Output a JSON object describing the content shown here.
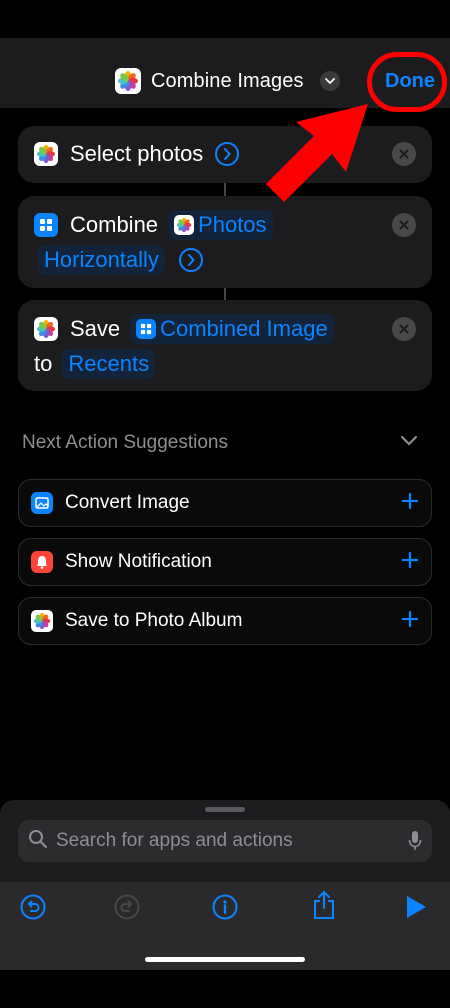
{
  "header": {
    "title": "Combine Images",
    "done_label": "Done"
  },
  "actions": {
    "select": {
      "label": "Select photos"
    },
    "combine": {
      "verb": "Combine",
      "input_token": "Photos",
      "mode_token": "Horizontally"
    },
    "save": {
      "verb": "Save",
      "input_token": "Combined Image",
      "to_word": "to",
      "album_token": "Recents"
    }
  },
  "suggestions": {
    "heading": "Next Action Suggestions",
    "items": [
      {
        "label": "Convert Image",
        "icon": "image-icon"
      },
      {
        "label": "Show Notification",
        "icon": "notification-icon"
      },
      {
        "label": "Save to Photo Album",
        "icon": "photos-icon"
      }
    ]
  },
  "search": {
    "placeholder": "Search for apps and actions"
  },
  "colors": {
    "accent": "#0a84ff",
    "annotation": "#ff0000",
    "background": "#000000",
    "card": "#1c1c1e"
  }
}
